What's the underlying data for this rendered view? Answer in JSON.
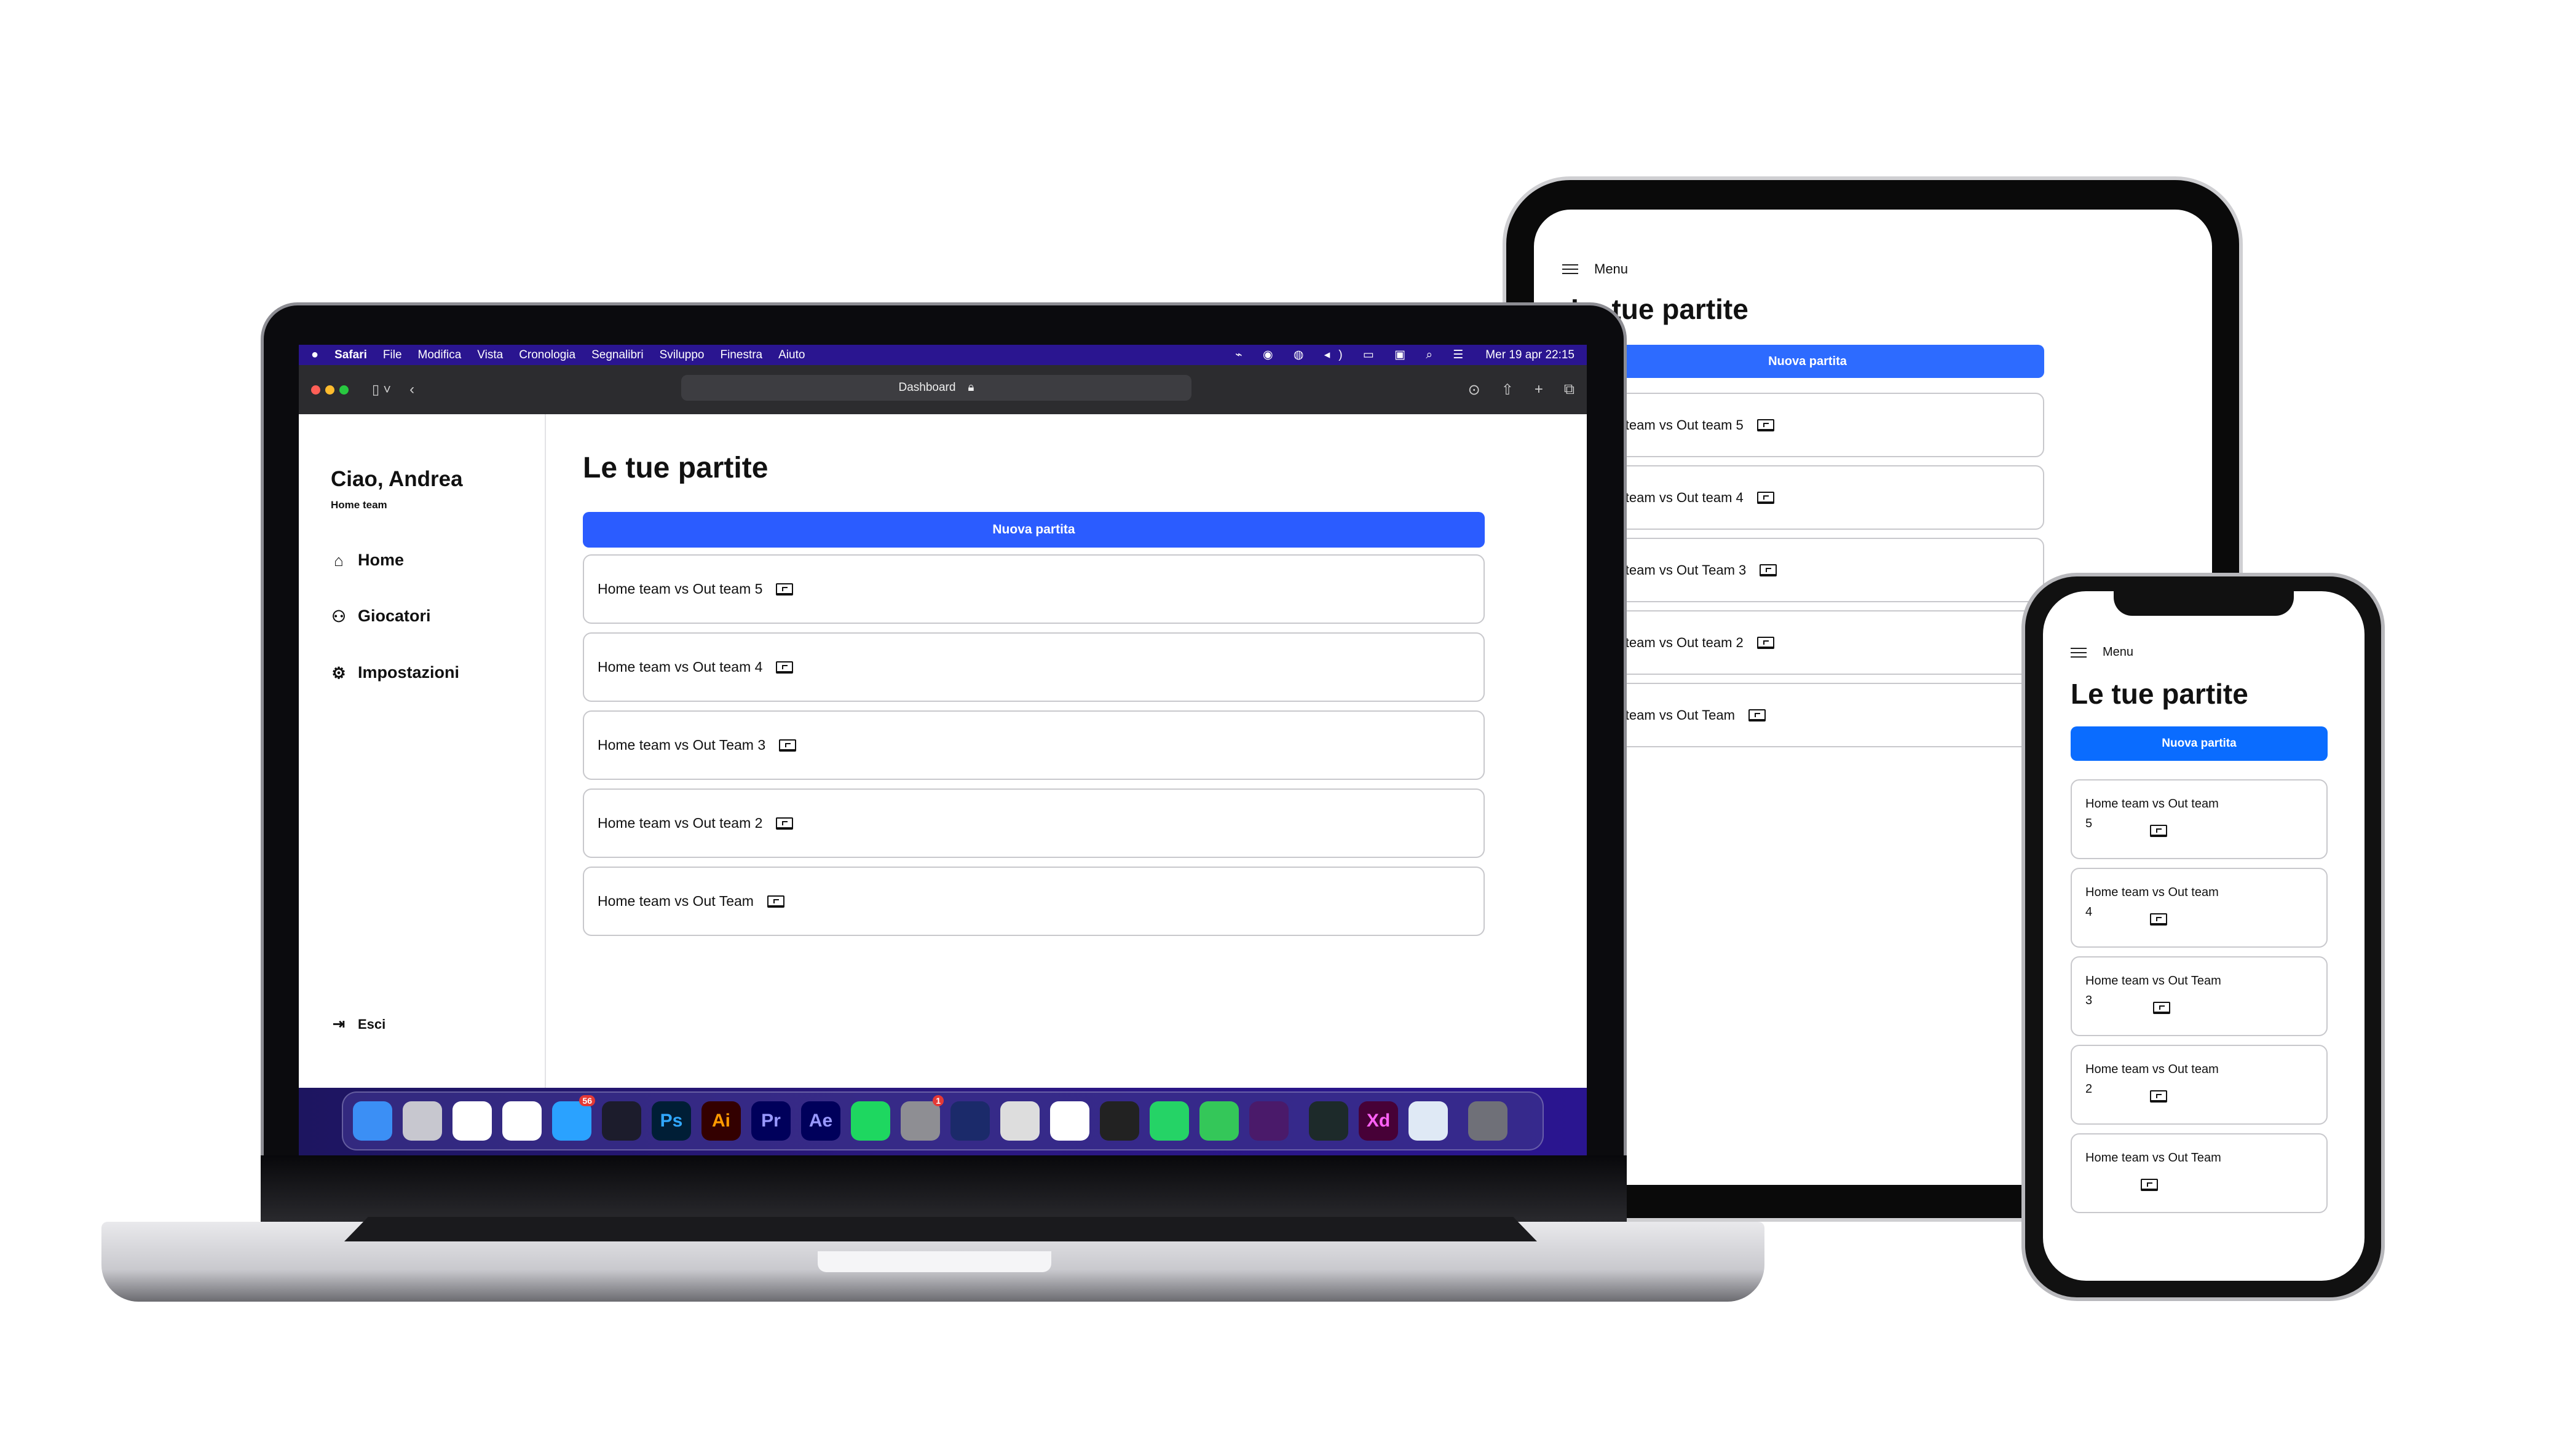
{
  "macos": {
    "menubar": [
      "Safari",
      "File",
      "Modifica",
      "Vista",
      "Cronologia",
      "Segnalibri",
      "Sviluppo",
      "Finestra",
      "Aiuto"
    ],
    "clock": "Mer 19 apr  22:15",
    "url_title": "Dashboard",
    "colors": {
      "menubar": "#2a1590",
      "toolbar": "#2c2c2f"
    }
  },
  "dock": [
    {
      "icon": "finder",
      "bg": "#3b8ff5",
      "t": ""
    },
    {
      "icon": "launchpad",
      "bg": "#c7c7cf",
      "t": ""
    },
    {
      "icon": "safari",
      "bg": "#fff",
      "t": ""
    },
    {
      "icon": "chrome",
      "bg": "#fff",
      "t": ""
    },
    {
      "icon": "mail",
      "bg": "#2aa2ff",
      "t": "",
      "badge": "56"
    },
    {
      "icon": "obs",
      "bg": "#1c1c2c",
      "t": ""
    },
    {
      "icon": "photoshop",
      "bg": "#001e36",
      "t": "Ps",
      "c": "#31a8ff"
    },
    {
      "icon": "illustrator",
      "bg": "#330000",
      "t": "Ai",
      "c": "#ff9a00"
    },
    {
      "icon": "premiere",
      "bg": "#00005b",
      "t": "Pr",
      "c": "#9999ff"
    },
    {
      "icon": "after-effects",
      "bg": "#00005b",
      "t": "Ae",
      "c": "#9999ff"
    },
    {
      "icon": "spotify",
      "bg": "#1ed760",
      "t": ""
    },
    {
      "icon": "system-settings",
      "bg": "#8e8e93",
      "t": "",
      "badge": "1"
    },
    {
      "icon": "cinema4d",
      "bg": "#1b2a6a",
      "t": ""
    },
    {
      "icon": "unity",
      "bg": "#ddd",
      "t": ""
    },
    {
      "icon": "vscode",
      "bg": "#fff",
      "t": ""
    },
    {
      "icon": "logic",
      "bg": "#222",
      "t": ""
    },
    {
      "icon": "whatsapp",
      "bg": "#25d366",
      "t": ""
    },
    {
      "icon": "facetime",
      "bg": "#34c759",
      "t": ""
    },
    {
      "icon": "siri",
      "bg": "#4a1a6a",
      "t": ""
    },
    {
      "icon": "audio-app",
      "bg": "#1d2a2a",
      "t": ""
    },
    {
      "icon": "xd",
      "bg": "#470137",
      "t": "Xd",
      "c": "#ff61f6"
    },
    {
      "icon": "preview",
      "bg": "#dfe9f5",
      "t": ""
    },
    {
      "icon": "trash",
      "bg": "#6f7078",
      "t": ""
    }
  ],
  "sidebar": {
    "greeting": "Ciao, Andrea",
    "team": "Home team",
    "items": [
      {
        "icon": "home-icon",
        "label": "Home"
      },
      {
        "icon": "users-icon",
        "label": "Giocatori"
      },
      {
        "icon": "gear-icon",
        "label": "Impostazioni"
      }
    ],
    "logout": "Esci"
  },
  "main": {
    "title": "Le tue partite",
    "new_button": "Nuova partita",
    "matches": [
      "Home team vs Out team 5",
      "Home team vs Out team 4",
      "Home team vs Out Team 3",
      "Home team vs Out team 2",
      "Home team vs Out Team"
    ]
  },
  "tablet": {
    "menu": "Menu",
    "title": "Le tue partite",
    "new_button": "Nuova partita",
    "matches": [
      "Home team vs Out team 5",
      "Home team vs Out team 4",
      "Home team vs Out Team 3",
      "Home team vs Out team 2",
      "Home team vs Out Team"
    ]
  },
  "phone": {
    "menu": "Menu",
    "title": "Le tue partite",
    "new_button": "Nuova partita",
    "matches": [
      "Home team vs Out team 5",
      "Home team vs Out team 4",
      "Home team vs Out Team 3",
      "Home team vs Out team 2",
      "Home team vs Out Team"
    ]
  },
  "colors": {
    "laptop_button": "#2b5cff",
    "tablet_button": "#2d6bff",
    "phone_button": "#0a6cff"
  }
}
